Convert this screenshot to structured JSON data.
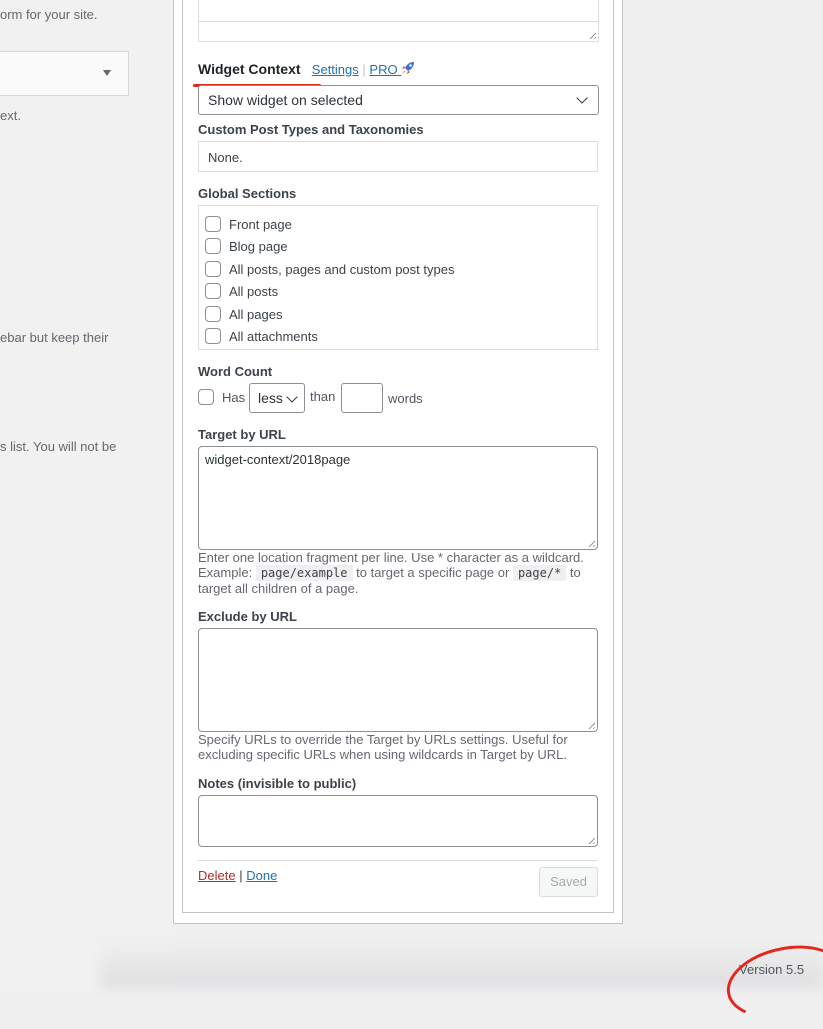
{
  "left_panel": {
    "text_1": "orm for your site.",
    "text_2": "ext.",
    "text_3": "ebar but keep their",
    "text_4": "s list. You will not be"
  },
  "widget_context": {
    "title": "Widget Context",
    "settings_link": "Settings",
    "separator": "|",
    "pro_link": "PRO",
    "pro_icon": "rocket-icon",
    "visibility_select": {
      "selected": "Show widget on selected"
    }
  },
  "custom_post_types": {
    "label": "Custom Post Types and Taxonomies",
    "value": "None."
  },
  "global_sections": {
    "label": "Global Sections",
    "items": [
      {
        "label": "Front page",
        "checked": false
      },
      {
        "label": "Blog page",
        "checked": false
      },
      {
        "label": "All posts, pages and custom post types",
        "checked": false
      },
      {
        "label": "All posts",
        "checked": false
      },
      {
        "label": "All pages",
        "checked": false
      },
      {
        "label": "All attachments",
        "checked": false
      }
    ]
  },
  "word_count": {
    "label": "Word Count",
    "has_label": "Has",
    "comparison_selected": "less",
    "than_label": "than",
    "value": "",
    "words_label": "words"
  },
  "target_by_url": {
    "label": "Target by URL",
    "value": "widget-context/2018page",
    "help_1": "Enter one location fragment per line. Use * character as a wildcard. Example: ",
    "help_code_1": "page/example",
    "help_2": " to target a specific page or ",
    "help_code_2": "page/*",
    "help_3": " to target all children of a page."
  },
  "exclude_by_url": {
    "label": "Exclude by URL",
    "value": "",
    "help": "Specify URLs to override the Target by URLs settings. Useful for excluding specific URLs when using wildcards in Target by URL."
  },
  "notes": {
    "label": "Notes (invisible to public)",
    "value": ""
  },
  "actions": {
    "delete": "Delete",
    "separator": "|",
    "done": "Done",
    "saved": "Saved"
  },
  "footer": {
    "version": "Version 5.5"
  },
  "colors": {
    "accent_link": "#2271b1",
    "delete_red": "#b32d2e",
    "annotation_red": "#e5261c"
  }
}
